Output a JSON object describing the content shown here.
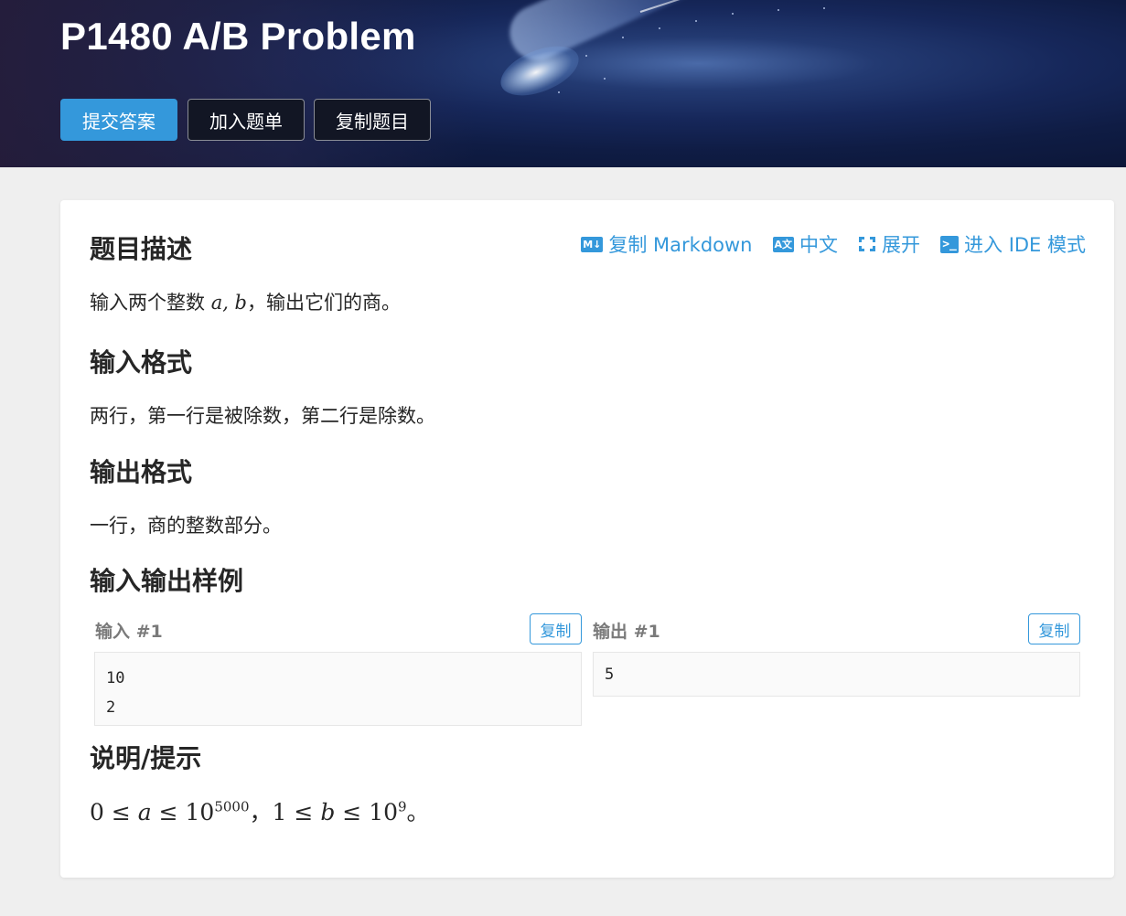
{
  "problem": {
    "title": "P1480 A/B Problem"
  },
  "header_buttons": {
    "submit": "提交答案",
    "add_to_list": "加入题单",
    "copy_problem": "复制题目"
  },
  "toolbar": {
    "copy_markdown": {
      "icon": "markdown-icon",
      "badge": "M↓",
      "label": "复制 Markdown"
    },
    "language": {
      "icon": "translate-icon",
      "badge": "A文",
      "label": "中文"
    },
    "expand": {
      "icon": "expand-icon",
      "label": "展开"
    },
    "ide": {
      "icon": "terminal-icon",
      "badge": ">_",
      "label": "进入 IDE 模式"
    }
  },
  "sections": {
    "description_title": "题目描述",
    "description_pre": "输入两个整数 ",
    "description_math": "a, b",
    "description_post": "，输出它们的商。",
    "input_title": "输入格式",
    "input_text": "两行，第一行是被除数，第二行是除数。",
    "output_title": "输出格式",
    "output_text": "一行，商的整数部分。",
    "samples_title": "输入输出样例",
    "hint_title": "说明/提示"
  },
  "samples": [
    {
      "input_label": "输入 #1",
      "output_label": "输出 #1",
      "input": "10\n2",
      "output": "5",
      "copy_label": "复制"
    }
  ],
  "hint": {
    "a_lower": "0",
    "a_var": "a",
    "a_base": "10",
    "a_exp": "5000",
    "sep": "，",
    "b_lower": "1",
    "b_var": "b",
    "b_base": "10",
    "b_exp": "9",
    "end": "。",
    "leq": "≤"
  },
  "colors": {
    "accent": "#3498db",
    "header_dark_button": "#121624",
    "page_background": "#efefef"
  }
}
